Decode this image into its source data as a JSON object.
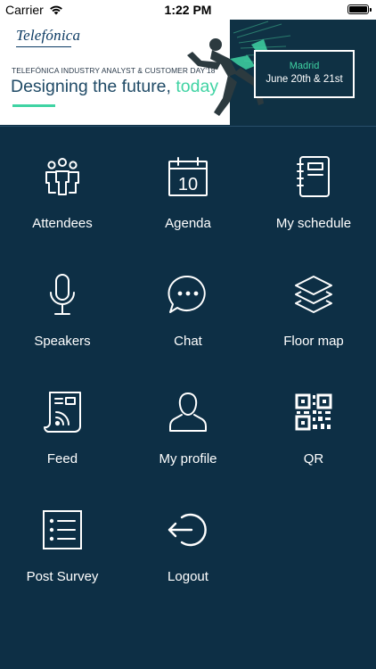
{
  "status_bar": {
    "carrier": "Carrier",
    "time": "1:22 PM",
    "battery_level": 1.0
  },
  "banner": {
    "brand": "Telefónica",
    "subtitle": "TELEFÓNICA INDUSTRY ANALYST & CUSTOMER DAY'18",
    "headline_main": "Designing the future, ",
    "headline_accent": "today",
    "city": "Madrid",
    "dates": "June 20th & 21st",
    "accent_color": "#3fd3a3",
    "background_dark": "#0f3144"
  },
  "menu": {
    "background": "#0d2f45",
    "items": [
      {
        "label": "Attendees",
        "icon": "people-icon"
      },
      {
        "label": "Agenda",
        "icon": "calendar-icon",
        "calendar_day": "10"
      },
      {
        "label": "My schedule",
        "icon": "notebook-icon"
      },
      {
        "label": "Speakers",
        "icon": "microphone-icon"
      },
      {
        "label": "Chat",
        "icon": "chat-bubble-icon"
      },
      {
        "label": "Floor map",
        "icon": "layers-icon"
      },
      {
        "label": "Feed",
        "icon": "rss-document-icon"
      },
      {
        "label": "My profile",
        "icon": "user-icon"
      },
      {
        "label": "QR",
        "icon": "qr-code-icon"
      },
      {
        "label": "Post Survey",
        "icon": "checklist-icon"
      },
      {
        "label": "Logout",
        "icon": "logout-icon"
      }
    ]
  }
}
